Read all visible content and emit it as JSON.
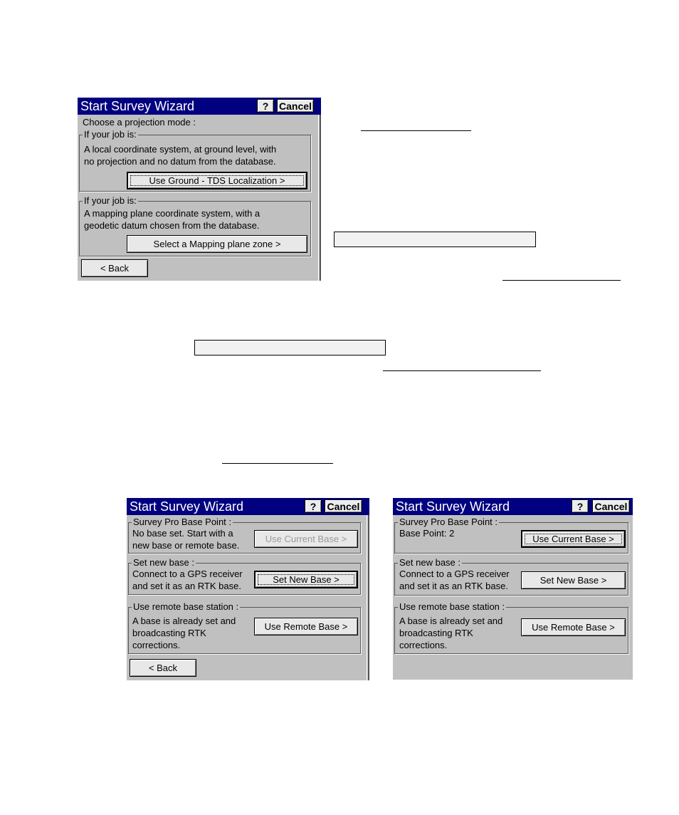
{
  "wizard1": {
    "title": "Start Survey Wizard",
    "help_label": "?",
    "cancel_label": "Cancel",
    "prompt": "Choose a projection mode :",
    "group1": {
      "label": "If your job is:",
      "line1": "A local coordinate system, at ground level, with",
      "line2": "no projection and no datum from the database.",
      "button": "Use Ground - TDS Localization >"
    },
    "group2": {
      "label": "If your job is:",
      "line1": "A mapping plane coordinate system, with a",
      "line2": "geodetic datum chosen from the database.",
      "button": "Select a Mapping plane zone >"
    },
    "back_label": "< Back"
  },
  "wizard2": {
    "title": "Start Survey Wizard",
    "help_label": "?",
    "cancel_label": "Cancel",
    "base_point": {
      "label": "Survey Pro Base Point :",
      "line1": "No base set. Start with a",
      "line2": "new base or remote base.",
      "button": "Use Current Base >"
    },
    "new_base": {
      "label": "Set new base :",
      "line1": "Connect to a GPS receiver",
      "line2": "and set it as an RTK base.",
      "button": "Set New Base >"
    },
    "remote_base": {
      "label": "Use remote base station :",
      "line1": "A base is already set and",
      "line2": "broadcasting RTK",
      "line3": "corrections.",
      "button": "Use Remote Base >"
    },
    "back_label": "< Back"
  },
  "wizard3": {
    "title": "Start Survey Wizard",
    "help_label": "?",
    "cancel_label": "Cancel",
    "base_point": {
      "label": "Survey Pro Base Point :",
      "line1": "Base Point: 2",
      "button": "Use Current Base >"
    },
    "new_base": {
      "label": "Set new base :",
      "line1": "Connect to a GPS receiver",
      "line2": "and set it as an RTK base.",
      "button": "Set New Base >"
    },
    "remote_base": {
      "label": "Use remote base station :",
      "line1": "A base is already set and",
      "line2": "broadcasting RTK",
      "line3": "corrections.",
      "button": "Use Remote Base >"
    }
  }
}
